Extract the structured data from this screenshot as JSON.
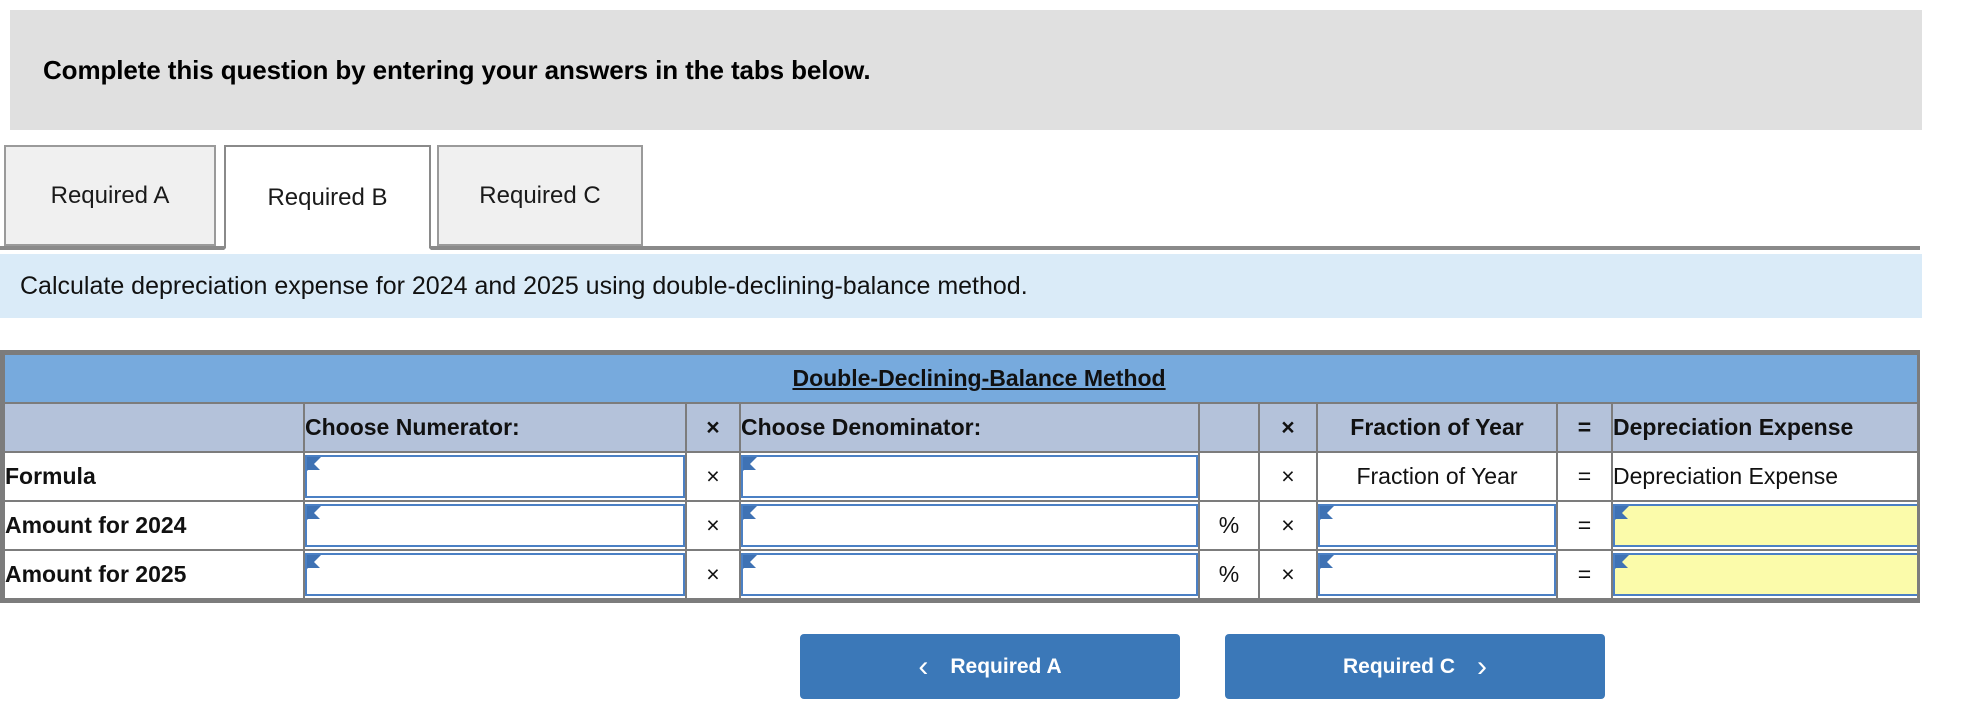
{
  "banner": {
    "text": "Complete this question by entering your answers in the tabs below."
  },
  "tabs": [
    {
      "label": "Required A",
      "active": false
    },
    {
      "label": "Required B",
      "active": true
    },
    {
      "label": "Required C",
      "active": false
    }
  ],
  "instruction": {
    "text": "Calculate depreciation expense for 2024 and 2025 using double-declining-balance method."
  },
  "worksheet": {
    "title": "Double-Declining-Balance Method",
    "headers": {
      "rowlabel": "",
      "numerator": "Choose Numerator:",
      "op1": "×",
      "denominator": "Choose Denominator:",
      "pct": "",
      "op2": "×",
      "fraction": "Fraction of Year",
      "equals": "=",
      "result": "Depreciation Expense"
    },
    "rows": [
      {
        "label": "Formula",
        "numerator_value": "",
        "op1": "×",
        "denominator_value": "",
        "pct": "",
        "op2": "×",
        "fraction_value": "Fraction of Year",
        "equals": "=",
        "result_value": "Depreciation Expense",
        "numerator_type": "dropdown",
        "denominator_type": "dropdown",
        "fraction_type": "text",
        "result_type": "text"
      },
      {
        "label": "Amount for 2024",
        "numerator_value": "",
        "op1": "×",
        "denominator_value": "",
        "pct": "%",
        "op2": "×",
        "fraction_value": "",
        "equals": "=",
        "result_value": "",
        "numerator_type": "dropdown",
        "denominator_type": "dropdown",
        "fraction_type": "dropdown",
        "result_type": "dropdown-yellow"
      },
      {
        "label": "Amount for 2025",
        "numerator_value": "",
        "op1": "×",
        "denominator_value": "",
        "pct": "%",
        "op2": "×",
        "fraction_value": "",
        "equals": "=",
        "result_value": "",
        "numerator_type": "dropdown",
        "denominator_type": "dropdown",
        "fraction_type": "dropdown",
        "result_type": "dropdown-yellow"
      }
    ]
  },
  "nav": {
    "prev_label": "Required A",
    "prev_icon": "chevron-left",
    "prev_glyph": "‹",
    "next_label": "Required C",
    "next_icon": "chevron-right",
    "next_glyph": "›"
  },
  "colors": {
    "banner_bg": "#e0e0e0",
    "instruction_bg": "#daebf8",
    "title_bg": "#77aadd",
    "header_bg": "#b4c2da",
    "input_border": "#4b80c4",
    "answer_bg": "#fbfbaa",
    "button_bg": "#3b78b8"
  }
}
